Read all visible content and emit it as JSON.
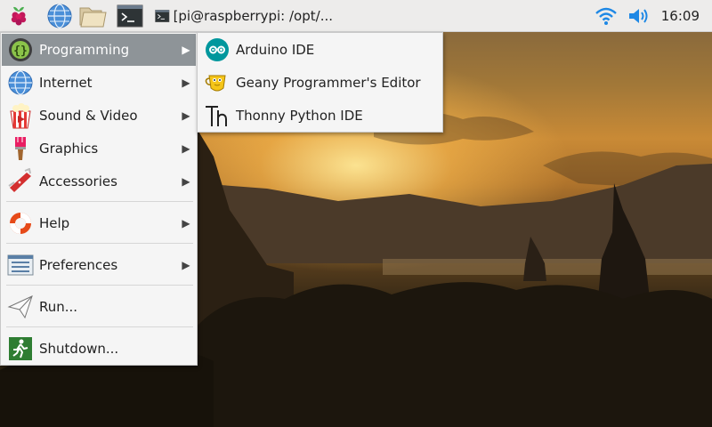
{
  "panel": {
    "icons": [
      "raspberry-menu-icon",
      "web-browser-icon",
      "file-manager-icon",
      "terminal-icon"
    ],
    "task": {
      "label": "[pi@raspberrypi: /opt/...",
      "icon": "terminal-icon"
    },
    "clock": "16:09"
  },
  "menu": {
    "items": [
      {
        "label": "Programming",
        "icon": "programming-icon",
        "submenu": true
      },
      {
        "label": "Internet",
        "icon": "internet-globe-icon",
        "submenu": true
      },
      {
        "label": "Sound & Video",
        "icon": "sound-video-icon",
        "submenu": true
      },
      {
        "label": "Graphics",
        "icon": "graphics-brush-icon",
        "submenu": true
      },
      {
        "label": "Accessories",
        "icon": "accessories-knife-icon",
        "submenu": true
      },
      {
        "label": "Help",
        "icon": "help-lifebuoy-icon",
        "submenu": true
      },
      {
        "label": "Preferences",
        "icon": "preferences-icon",
        "submenu": true
      },
      {
        "label": "Run...",
        "icon": "run-paper-plane-icon",
        "submenu": false
      },
      {
        "label": "Shutdown...",
        "icon": "shutdown-exit-icon",
        "submenu": false
      }
    ]
  },
  "submenu": {
    "items": [
      {
        "label": "Arduino IDE",
        "icon": "arduino-icon"
      },
      {
        "label": "Geany Programmer's Editor",
        "icon": "geany-icon"
      },
      {
        "label": "Thonny Python IDE",
        "icon": "thonny-icon"
      }
    ]
  },
  "colors": {
    "panel": "#edeceb",
    "menu_bg": "#f5f5f5",
    "highlight": "#8e9498",
    "system_blue": "#1e88e5"
  }
}
